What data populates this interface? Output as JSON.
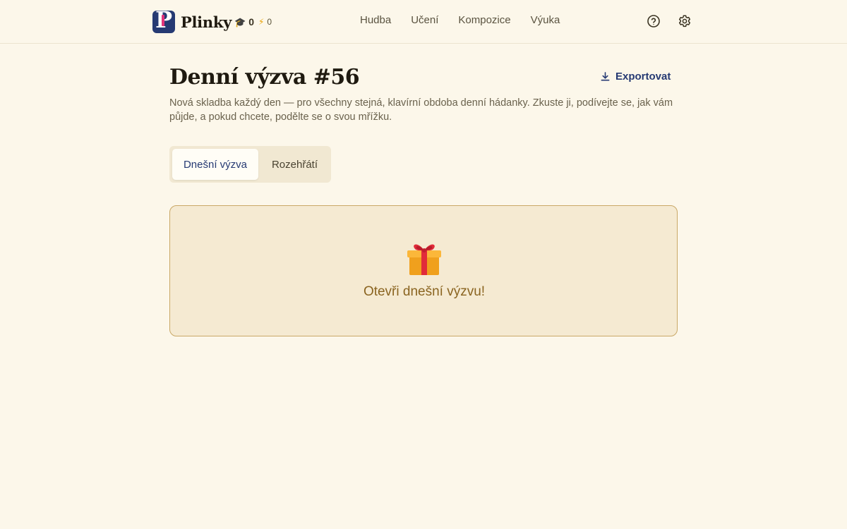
{
  "header": {
    "brand_name": "Plinky",
    "stats": {
      "graduation_count": "0",
      "streak_count": "0"
    },
    "nav": [
      {
        "label": "Hudba"
      },
      {
        "label": "Učení"
      },
      {
        "label": "Kompozice"
      },
      {
        "label": "Výuka"
      }
    ],
    "icons": [
      "help-icon",
      "settings-icon"
    ]
  },
  "main": {
    "title": "Denní výzva #56",
    "export_label": "Exportovat",
    "subtitle": "Nová skladba každý den — pro všechny stejná, klavírní obdoba denní hádanky. Zkuste ji, podívejte se, jak vám půjde, a pokud chcete, podělte se o svou mřížku.",
    "tabs": [
      {
        "label": "Dnešní výzva",
        "active": true
      },
      {
        "label": "Rozehřátí",
        "active": false
      }
    ],
    "card": {
      "icon": "gift-icon",
      "cta": "Otevři dnešní výzvu!"
    }
  },
  "colors": {
    "background": "#fcf7ea",
    "brand": "#263a73",
    "brand_accent": "#e0337a",
    "card_bg": "#f5ead2",
    "card_border": "#c9a866",
    "cta_text": "#8a6420"
  }
}
